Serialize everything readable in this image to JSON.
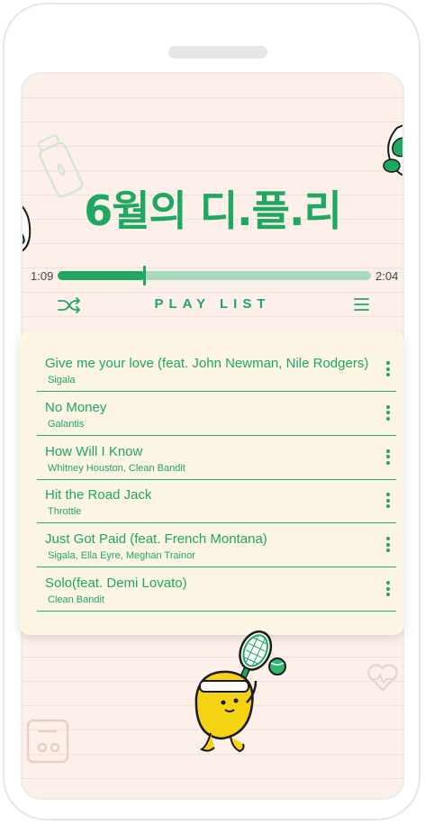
{
  "header": {
    "title": "6월의 디.플.리"
  },
  "player": {
    "current_time": "1:09",
    "total_time": "2:04",
    "progress_percent": 28,
    "section_label": "PLAY LIST",
    "accent_color": "#1fa85f",
    "track_color": "#a8dbbe"
  },
  "playlist": {
    "tracks": [
      {
        "title": "Give me your love (feat. John Newman, Nile Rodgers)",
        "artist": "Sigala"
      },
      {
        "title": "No Money",
        "artist": "Galantis"
      },
      {
        "title": "How Will I Know",
        "artist": "Whitney Houston, Clean Bandit"
      },
      {
        "title": "Hit the Road Jack",
        "artist": "Throttle"
      },
      {
        "title": "Just Got Paid (feat. French Montana)",
        "artist": "Sigala, Ella Eyre, Meghan Trainor"
      },
      {
        "title": "Solo(feat. Demi Lovato)",
        "artist": "Clean Bandit"
      }
    ]
  },
  "icons": {
    "shuffle": "shuffle-icon",
    "menu": "hamburger-menu-icon",
    "more": "kebab-more-icon",
    "decorations": [
      "bottle-icon",
      "mascot-icon",
      "scale-icon",
      "heart-icon",
      "tennis-mascot-icon"
    ]
  }
}
